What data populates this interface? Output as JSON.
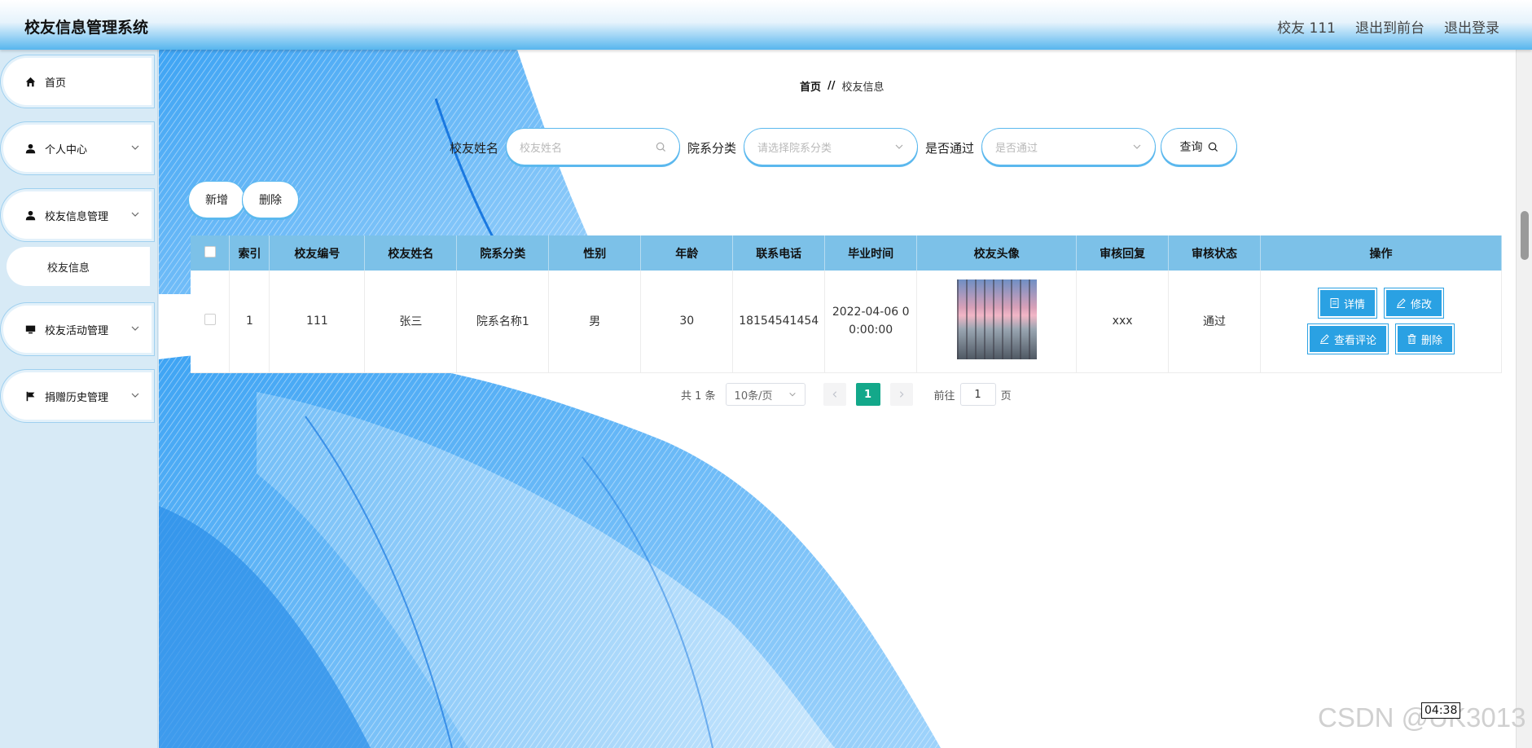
{
  "header": {
    "title": "校友信息管理系统",
    "user": "校友 111",
    "to_front": "退出到前台",
    "logout": "退出登录"
  },
  "sidebar": {
    "items": [
      {
        "label": "首页",
        "icon": "home-icon"
      },
      {
        "label": "个人中心",
        "icon": "user-icon"
      },
      {
        "label": "校友信息管理",
        "icon": "user-icon"
      },
      {
        "label": "校友活动管理",
        "icon": "monitor-icon"
      },
      {
        "label": "捐赠历史管理",
        "icon": "flag-icon"
      }
    ],
    "submenu": {
      "label": "校友信息"
    }
  },
  "breadcrumb": {
    "home": "首页",
    "sep": "//",
    "current": "校友信息"
  },
  "search": {
    "name_label": "校友姓名",
    "name_placeholder": "校友姓名",
    "dept_label": "院系分类",
    "dept_placeholder": "请选择院系分类",
    "pass_label": "是否通过",
    "pass_placeholder": "是否通过",
    "query_label": "查询"
  },
  "actions": {
    "add": "新增",
    "delete": "删除"
  },
  "table": {
    "headers": [
      "索引",
      "校友编号",
      "校友姓名",
      "院系分类",
      "性别",
      "年龄",
      "联系电话",
      "毕业时间",
      "校友头像",
      "审核回复",
      "审核状态",
      "操作"
    ],
    "rows": [
      {
        "index": "1",
        "number": "111",
        "name": "张三",
        "dept": "院系名称1",
        "gender": "男",
        "age": "30",
        "phone": "18154541454",
        "grad_line1": "2022-04-06 0",
        "grad_line2": "0:00:00",
        "reply": "xxx",
        "status": "通过"
      }
    ],
    "ops": {
      "detail": "详情",
      "edit": "修改",
      "comments": "查看评论",
      "delete": "删除"
    }
  },
  "pagination": {
    "total": "共 1 条",
    "page_size": "10条/页",
    "current": "1",
    "goto_prefix": "前往",
    "goto_value": "1",
    "goto_suffix": "页"
  },
  "overlay": {
    "time": "04:38",
    "watermark": "CSDN @UK3013"
  },
  "colors": {
    "accent": "#2aa1e3",
    "header_row": "#7cc1e8",
    "page_active": "#13a88a"
  }
}
